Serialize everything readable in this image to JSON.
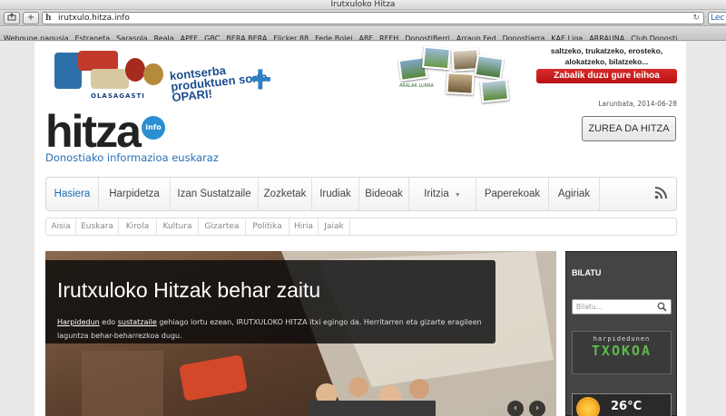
{
  "window": {
    "title": "Irutxuloko Hitza"
  },
  "toolbar": {
    "share_icon": "share-icon",
    "add_label": "+",
    "url": "irutxulo.hitza.info",
    "favicon": "h",
    "reload_icon": "reload-icon",
    "right_tab": "Lec"
  },
  "bookmarks": [
    "Webgune nagusia",
    "Estraneta",
    "Sarasola",
    "Reala",
    "APFF",
    "GBC",
    "BERA BERA",
    "Flicker 88",
    "Fede Bolei",
    "ABF",
    "RFEH",
    "DonostiBerri",
    "Arraun Fed",
    "Donostiarra",
    "KAE Liga",
    "ARRAUNA",
    "Club Donosti"
  ],
  "ads": {
    "left": {
      "headline": "kontserba produktuen sorta OPARI!",
      "plus": "+",
      "brand": "OLASAGASTI"
    },
    "middle": {
      "logo_text": "ARALAR LURRA"
    },
    "right": {
      "text": "saltzeko, trukatzeko, erosteko, alokatzeko, bilatzeko...",
      "button": "Zabalik duzu gure leihoa"
    }
  },
  "header": {
    "date": "Larunbata, 2014-06-28",
    "subscribe_button": "ZUREA DA HITZA",
    "logo": "hitza",
    "logo_badge": "info",
    "tagline": "Donostiako informazioa euskaraz"
  },
  "main_nav": [
    "Hasiera",
    "Harpidetza",
    "Izan Sustatzaile",
    "Zozketak",
    "Irudiak",
    "Bideoak",
    "Iritzia",
    "Paperekoak",
    "Agiriak"
  ],
  "main_nav_active": "Hasiera",
  "sub_nav": [
    "Aisia",
    "Euskara",
    "Kirola",
    "Kultura",
    "Gizartea",
    "Politika",
    "Hiria",
    "Jaiak"
  ],
  "slider": {
    "title": "Irutxuloko Hitzak behar zaitu",
    "link1": "Harpidedun",
    "mid1": " edo ",
    "link2": "sustatzaile",
    "body": " gehiago lortu ezean, IRUTXULOKO HITZA itxi egingo da. Herritarren eta gizarte eragileen laguntza behar-beharrezkoa dugu.",
    "prev": "‹",
    "next": "›"
  },
  "sidebar": {
    "search_title": "BILATU",
    "search_placeholder": "Bilatu...",
    "txoko_small": "harpidedunen",
    "txoko_big": "TXOKOA",
    "weather_icon": "sun-icon",
    "temperature": "26°C"
  },
  "colors": {
    "accent": "#1a6fb8",
    "red_button": "#c81c1c",
    "txoko_green": "#5fb94a"
  }
}
